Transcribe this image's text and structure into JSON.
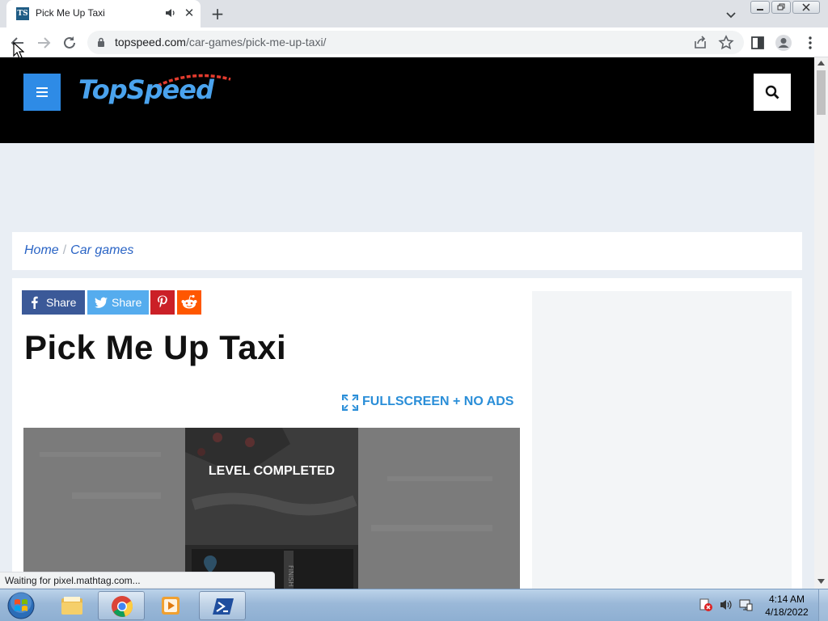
{
  "browser": {
    "tab": {
      "title": "Pick Me Up Taxi",
      "favicon": "TS",
      "close_glyph": "✕"
    },
    "new_tab_glyph": "+",
    "url": {
      "host": "topspeed.com",
      "path": "/car-games/pick-me-up-taxi/"
    },
    "status_text": "Waiting for pixel.mathtag.com..."
  },
  "site": {
    "logo_text": "TopSpeed",
    "brand_color": "#4aa3ee",
    "accent_color": "#2e8be6",
    "breadcrumb": {
      "home": "Home",
      "separator": "/",
      "section": "Car games"
    },
    "share": {
      "facebook": "Share",
      "twitter": "Share",
      "facebook_color": "#3b5998",
      "twitter_color": "#55acee",
      "pinterest_color": "#cb2027",
      "reddit_color": "#ff5700"
    },
    "page_title": "Pick Me Up Taxi",
    "fullscreen_label": "FULLSCREEN + NO ADS",
    "game": {
      "overlay_text": "LEVEL COMPLETED"
    }
  },
  "taskbar": {
    "clock": {
      "time": "4:14 AM",
      "date": "4/18/2022"
    },
    "apps": [
      "windows-explorer",
      "chrome",
      "media-player",
      "powershell"
    ]
  }
}
